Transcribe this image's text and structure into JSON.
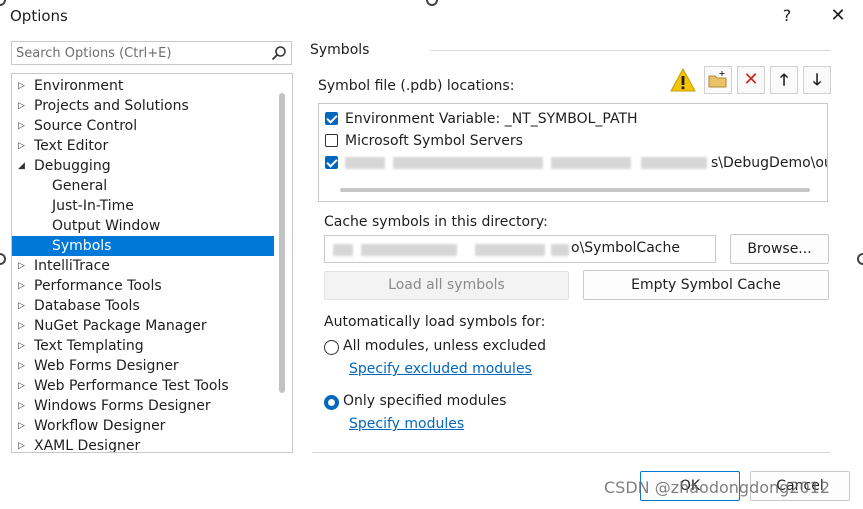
{
  "window": {
    "title": "Options",
    "help_label": "?",
    "close_label": "✕"
  },
  "search": {
    "placeholder": "Search Options (Ctrl+E)",
    "value": ""
  },
  "tree": {
    "items": [
      {
        "label": "Environment",
        "state": "collapsed"
      },
      {
        "label": "Projects and Solutions",
        "state": "collapsed"
      },
      {
        "label": "Source Control",
        "state": "collapsed"
      },
      {
        "label": "Text Editor",
        "state": "collapsed"
      },
      {
        "label": "Debugging",
        "state": "expanded"
      },
      {
        "label": "General",
        "state": "child"
      },
      {
        "label": "Just-In-Time",
        "state": "child"
      },
      {
        "label": "Output Window",
        "state": "child"
      },
      {
        "label": "Symbols",
        "state": "child-selected"
      },
      {
        "label": "IntelliTrace",
        "state": "collapsed"
      },
      {
        "label": "Performance Tools",
        "state": "collapsed"
      },
      {
        "label": "Database Tools",
        "state": "collapsed"
      },
      {
        "label": "NuGet Package Manager",
        "state": "collapsed"
      },
      {
        "label": "Text Templating",
        "state": "collapsed"
      },
      {
        "label": "Web Forms Designer",
        "state": "collapsed"
      },
      {
        "label": "Web Performance Test Tools",
        "state": "collapsed"
      },
      {
        "label": "Windows Forms Designer",
        "state": "collapsed"
      },
      {
        "label": "Workflow Designer",
        "state": "collapsed"
      },
      {
        "label": "XAML Designer",
        "state": "collapsed"
      }
    ]
  },
  "symbols": {
    "section_title": "Symbols",
    "locations_label": "Symbol file (.pdb) locations:",
    "toolbar_icons": [
      "warning-icon",
      "new-folder-icon",
      "delete-icon",
      "move-up-icon",
      "move-down-icon"
    ],
    "toolbar_glyphs": {
      "delete": "✕",
      "up": "🡑",
      "down": "🡓"
    },
    "locations": [
      {
        "label": "Environment Variable: _NT_SYMBOL_PATH",
        "checked": true
      },
      {
        "label": "Microsoft Symbol Servers",
        "checked": false
      },
      {
        "label": "s\\DebugDemo\\ou",
        "checked": true
      }
    ],
    "cache_label": "Cache symbols in this directory:",
    "cache_value": "o\\SymbolCache",
    "browse_label": "Browse...",
    "load_all_label": "Load all symbols",
    "empty_cache_label": "Empty Symbol Cache",
    "auto_load_label": "Automatically load symbols for:",
    "radio_all_label": "All modules, unless excluded",
    "radio_all_selected": false,
    "link_excluded": "Specify excluded modules",
    "radio_specified_label": "Only specified modules",
    "radio_specified_selected": true,
    "link_modules": "Specify modules"
  },
  "footer": {
    "ok_label": "OK",
    "cancel_label": "Cancel",
    "watermark": "CSDN @zhaodongdong2012"
  },
  "colors": {
    "accent": "#0078d7",
    "link": "#0067c0",
    "warning": "#f5c400",
    "delete": "#c42b1c"
  }
}
